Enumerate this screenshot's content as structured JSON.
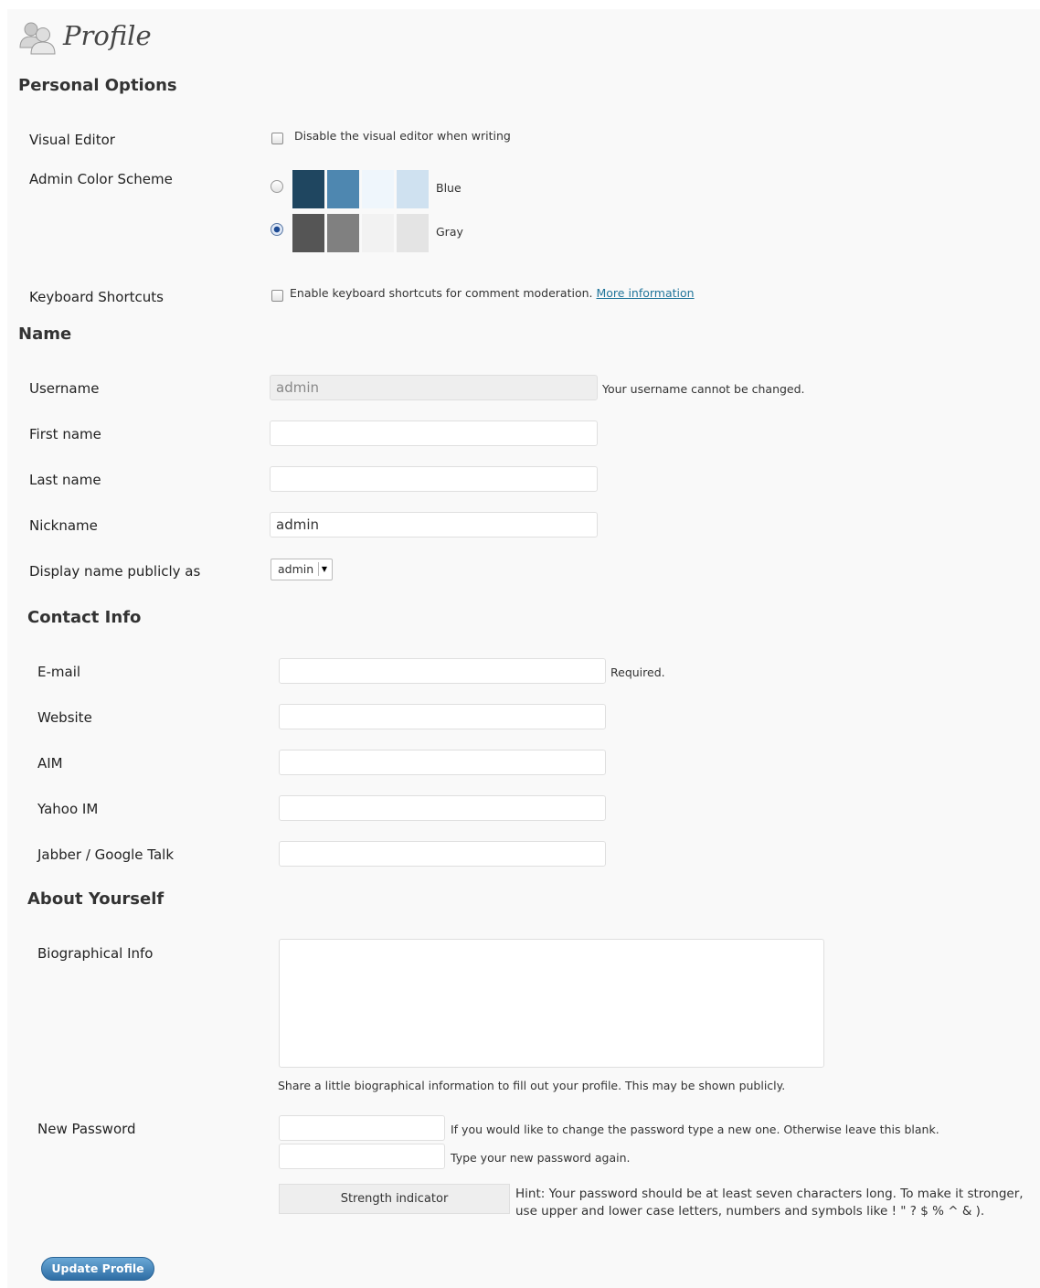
{
  "page": {
    "title": "Profile",
    "icon": "users-icon"
  },
  "personal_options": {
    "heading": "Personal Options",
    "visual_editor": {
      "label": "Visual Editor",
      "checkbox_text": "Disable the visual editor when writing",
      "checked": false
    },
    "color_scheme": {
      "label": "Admin Color Scheme",
      "options": [
        {
          "name": "Blue",
          "selected": false,
          "colors": [
            "#1f4660",
            "#4e87b0",
            "#eff6fc",
            "#cfe1f0"
          ]
        },
        {
          "name": "Gray",
          "selected": true,
          "colors": [
            "#555555",
            "#808080",
            "#f2f2f2",
            "#e4e4e4"
          ]
        }
      ]
    },
    "keyboard_shortcuts": {
      "label": "Keyboard Shortcuts",
      "checkbox_text": "Enable keyboard shortcuts for comment moderation.",
      "link_text": "More information",
      "checked": false
    }
  },
  "name": {
    "heading": "Name",
    "username": {
      "label": "Username",
      "value": "admin",
      "note": "Your username cannot be changed."
    },
    "first_name": {
      "label": "First name",
      "value": ""
    },
    "last_name": {
      "label": "Last name",
      "value": ""
    },
    "nickname": {
      "label": "Nickname",
      "value": "admin"
    },
    "display_name": {
      "label": "Display name publicly as",
      "selected": "admin"
    }
  },
  "contact": {
    "heading": "Contact Info",
    "email": {
      "label": "E-mail",
      "value": "",
      "note": "Required."
    },
    "website": {
      "label": "Website",
      "value": ""
    },
    "aim": {
      "label": "AIM",
      "value": ""
    },
    "yahoo": {
      "label": "Yahoo IM",
      "value": ""
    },
    "jabber": {
      "label": "Jabber / Google Talk",
      "value": ""
    }
  },
  "about": {
    "heading": "About Yourself",
    "bio": {
      "label": "Biographical Info",
      "value": "",
      "note": "Share a little biographical information to fill out your profile. This may be shown publicly."
    },
    "password": {
      "label": "New Password",
      "note1": "If you would like to change the password type a new one. Otherwise leave this blank.",
      "note2": "Type your new password again.",
      "strength_label": "Strength indicator",
      "hint_line1": "Hint: Your password should be at least seven characters long. To make it stronger,",
      "hint_line2": "use upper and lower case letters, numbers and symbols like ! \" ? $ % ^ & )."
    }
  },
  "submit": {
    "label": "Update Profile"
  }
}
